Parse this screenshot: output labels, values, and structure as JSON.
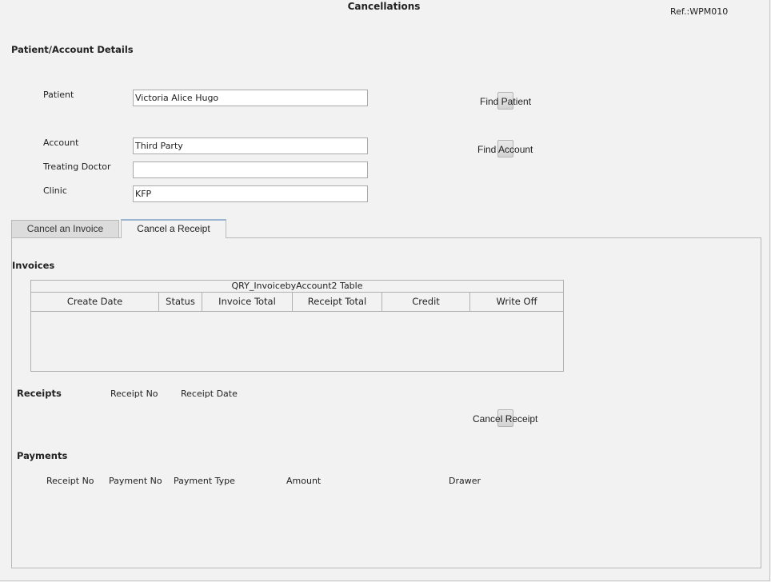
{
  "header": {
    "title": "Cancellations",
    "ref": "Ref.:WPM010"
  },
  "details": {
    "section_title": "Patient/Account Details",
    "patient_label": "Patient",
    "patient_value": "Victoria Alice Hugo",
    "account_label": "Account",
    "account_value": "Third Party",
    "doctor_label": "Treating Doctor",
    "doctor_value": "",
    "clinic_label": "Clinic",
    "clinic_value": "KFP",
    "find_patient_label": "Find Patient",
    "find_account_label": "Find Account"
  },
  "tabs": [
    {
      "label": "Cancel an Invoice"
    },
    {
      "label": "Cancel a Receipt"
    }
  ],
  "invoices": {
    "section_title": "Invoices",
    "table_caption": "QRY_InvoicebyAccount2 Table",
    "columns": [
      "Create Date",
      "Status",
      "Invoice Total",
      "Receipt Total",
      "Credit",
      "Write Off"
    ]
  },
  "receipts": {
    "section_title": "Receipts",
    "columns": [
      "Receipt No",
      "Receipt Date"
    ],
    "cancel_label": "Cancel Receipt"
  },
  "payments": {
    "section_title": "Payments",
    "columns": [
      "Receipt No",
      "Payment No",
      "Payment Type",
      "Amount",
      "Drawer"
    ]
  }
}
